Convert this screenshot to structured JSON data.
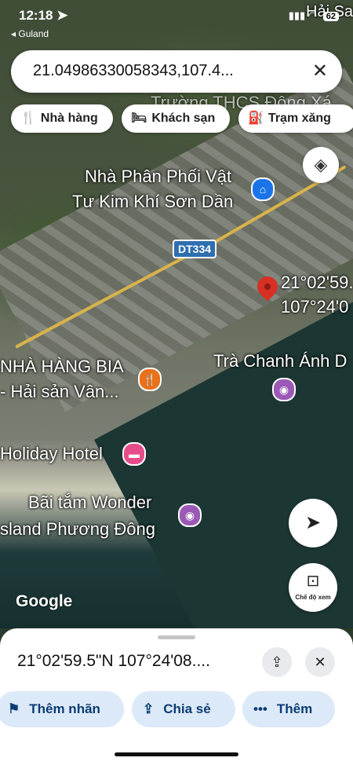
{
  "status_bar": {
    "time": "12:18 ➤",
    "back_app": "◂ Guland",
    "signal": "▮▮▮ ◠",
    "battery": "62",
    "corner_label": "Hải Sa"
  },
  "search": {
    "value": "21.04986330058343,107.4...",
    "close": "✕"
  },
  "chips": [
    {
      "icon": "fork-knife-icon",
      "glyph": "🍴",
      "label": "Nhà hàng"
    },
    {
      "icon": "bed-icon",
      "glyph": "🛏",
      "label": "Khách sạn"
    },
    {
      "icon": "gas-pump-icon",
      "glyph": "⛽",
      "label": "Trạm xăng"
    }
  ],
  "map": {
    "labels": {
      "school": "Trường THCS Đông Xá",
      "distributor_1": "Nhà Phân Phối Vật",
      "distributor_2": "Tư Kim Khí Sơn Dần",
      "coord_1": "21°02'59.",
      "coord_2": "107°24'0",
      "restaurant_1": "NHÀ HÀNG BIA",
      "restaurant_2": "- Hải sản Vân...",
      "tea": "Trà Chanh Ánh D",
      "hotel": "Holiday Hotel",
      "beach_1": "Bãi tắm Wonder",
      "beach_2": "sland Phương Đông"
    },
    "road_shield": "DT334",
    "google": "Google",
    "colors": {
      "shop": "#1a73e8",
      "food": "#e8711a",
      "hotel": "#e84b8a",
      "camera": "#9b59b6",
      "pin": "#d93025"
    }
  },
  "controls": {
    "layers_glyph": "◈",
    "locate_glyph": "➤",
    "street_glyph": "⊡",
    "street_label": "Chế độ xem"
  },
  "sheet": {
    "coordinates": "21°02'59.5\"N 107°24'08....",
    "share_glyph": "⇪",
    "close_glyph": "✕",
    "actions": [
      {
        "icon": "flag-icon",
        "glyph": "⚑",
        "label": "Thêm nhãn"
      },
      {
        "icon": "share-icon",
        "glyph": "⇪",
        "label": "Chia sẻ"
      },
      {
        "icon": "more-icon",
        "glyph": "•••",
        "label": "Thêm"
      }
    ]
  }
}
